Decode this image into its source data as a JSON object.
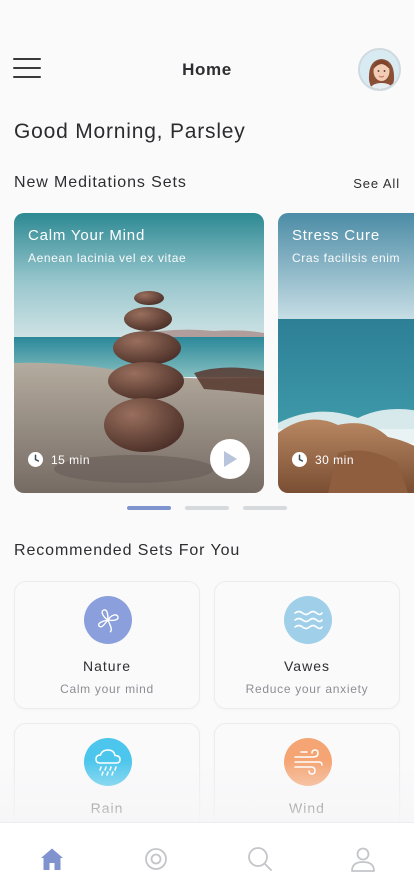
{
  "header": {
    "title": "Home",
    "menu_icon": "hamburger-menu-icon",
    "avatar_icon": "user-avatar"
  },
  "greeting": "Good Morning, Parsley",
  "new_sets": {
    "title": "New Meditations Sets",
    "see_all": "See All",
    "cards": [
      {
        "title": "Calm Your Mind",
        "subtitle": "Aenean lacinia vel ex vitae",
        "duration": "15 min",
        "icon": "clock-icon",
        "play_icon": "play-icon"
      },
      {
        "title": "Stress Cure",
        "subtitle": "Cras facilisis enim",
        "duration": "30 min",
        "icon": "clock-icon"
      }
    ],
    "pagination": {
      "count": 3,
      "active_index": 0
    }
  },
  "recommended": {
    "title": "Recommended Sets For You",
    "items": [
      {
        "name": "Nature",
        "subtitle": "Calm your mind",
        "icon": "clover-icon",
        "color": "#8a9fdc"
      },
      {
        "name": "Vawes",
        "subtitle": "Reduce your anxiety",
        "icon": "waves-icon",
        "color": "#9fcfe9"
      },
      {
        "name": "Rain",
        "subtitle": "",
        "icon": "rain-cloud-icon",
        "color": "#4cc6ec"
      },
      {
        "name": "Wind",
        "subtitle": "",
        "icon": "wind-icon",
        "color": "#f5a574"
      }
    ]
  },
  "tabbar": {
    "items": [
      {
        "name": "home",
        "icon": "home-icon",
        "active": true
      },
      {
        "name": "meditate",
        "icon": "target-icon",
        "active": false
      },
      {
        "name": "search",
        "icon": "search-icon",
        "active": false
      },
      {
        "name": "profile",
        "icon": "profile-icon",
        "active": false
      }
    ],
    "active_color": "#7f93cf",
    "inactive_color": "#c4c5c9"
  }
}
